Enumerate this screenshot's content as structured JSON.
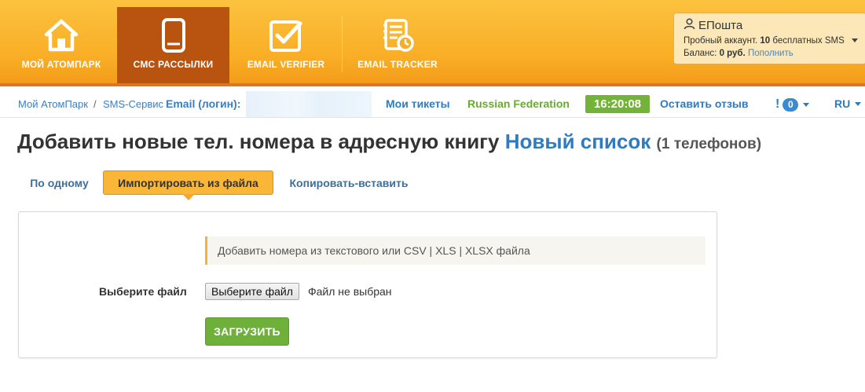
{
  "nav": {
    "items": [
      {
        "label": "Мой АтомПарк",
        "icon": "home-icon",
        "active": false
      },
      {
        "label": "СМС рассылки",
        "icon": "phone-icon",
        "active": true
      },
      {
        "label": "Email verifier",
        "icon": "checkbox-icon",
        "active": false
      },
      {
        "label": "Email tracker",
        "icon": "tracker-icon",
        "active": false
      }
    ]
  },
  "account": {
    "name": "ЕПошта",
    "trial_prefix": "Пробный аккаунт.",
    "free_count": "10",
    "free_suffix": "бесплатных SMS",
    "balance_label": "Баланс:",
    "balance_value": "0 руб.",
    "topup_link": "Пополнить"
  },
  "subbar": {
    "breadcrumb_home": "Мой АтомПарк",
    "breadcrumb_sep": "/",
    "breadcrumb_service": "SMS-Сервис",
    "email_login_label": "Email (логин):",
    "tickets": "Мои тикеты",
    "country": "Russian Federation",
    "time": "16:20:08",
    "feedback": "Оставить отзыв",
    "notifications_icon": "!",
    "notifications_count": "0",
    "language": "RU"
  },
  "title": {
    "prefix": "Добавить новые тел. номера в адресную книгу",
    "list_name": "Новый список",
    "count": "(1 телефонов)"
  },
  "tabs": [
    {
      "label": "По одному",
      "active": false
    },
    {
      "label": "Импортировать из файла",
      "active": true
    },
    {
      "label": "Копировать-вставить",
      "active": false
    }
  ],
  "form": {
    "info_text": "Добавить номера из текстового или CSV | XLS | XLSX файла",
    "file_label": "Выберите файл",
    "file_button": "Выберите файл",
    "file_status": "Файл не выбран",
    "upload_button": "ЗАГРУЗИТЬ"
  },
  "colors": {
    "header": "#f9ad25",
    "active_nav": "#b8540f",
    "link": "#2f7bbf",
    "green": "#6fb03b"
  }
}
